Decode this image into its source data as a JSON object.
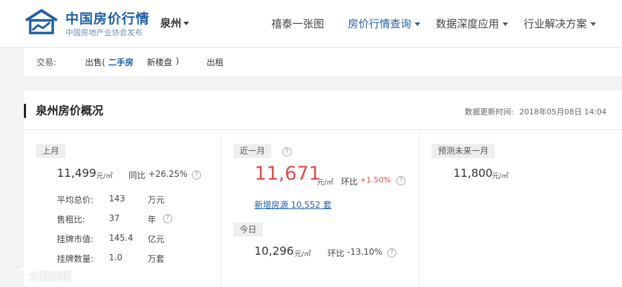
{
  "header": {
    "brand_title": "中国房价行情",
    "brand_subtitle": "中国房地产业协会发布",
    "city": "泉州",
    "nav": [
      "禧泰一张图",
      "房价行情查询",
      "数据深度应用",
      "行业解决方案"
    ],
    "active_nav": "房价行情查询",
    "accent_color": "#1d5fa8"
  },
  "filter": {
    "label": "交易:",
    "sale": "出售(",
    "second_hand": "二手房",
    "new_house": "新楼盘",
    "close_paren": ")",
    "rent": "出租"
  },
  "overview": {
    "title": "泉州房价概况",
    "update_label": "数据更新时间:",
    "update_time": "2018年05月08日 14:04",
    "last_month": {
      "tag": "上月",
      "price": "11,499",
      "unit": "元/㎡",
      "yoy_label": "同比",
      "yoy_value": "+26.25%",
      "rows": [
        {
          "label": "平均总价:",
          "value": "143",
          "unit": "万元"
        },
        {
          "label": "售租比:",
          "value": "37",
          "unit": "年"
        },
        {
          "label": "挂牌市值:",
          "value": "145.4",
          "unit": "亿元"
        },
        {
          "label": "挂牌数量:",
          "value": "1.0",
          "unit": "万套"
        }
      ]
    },
    "recent_month": {
      "tag": "近一月",
      "price": "11,671",
      "unit": "元/㎡",
      "mom_label": "环比",
      "mom_value": "+1.50%",
      "new_listings_label": "新增房源",
      "new_listings_value": "10,552",
      "new_listings_unit": "套",
      "price_color": "#e44a4a"
    },
    "today": {
      "tag": "今日",
      "price": "10,296",
      "unit": "元/㎡",
      "mom_label": "环比",
      "mom_value": "-13.10%"
    },
    "forecast": {
      "tag": "预测未来一月",
      "price": "11,800",
      "unit": "元/㎡"
    }
  },
  "watermark": "大数跨境",
  "icons": {
    "help": "?"
  }
}
